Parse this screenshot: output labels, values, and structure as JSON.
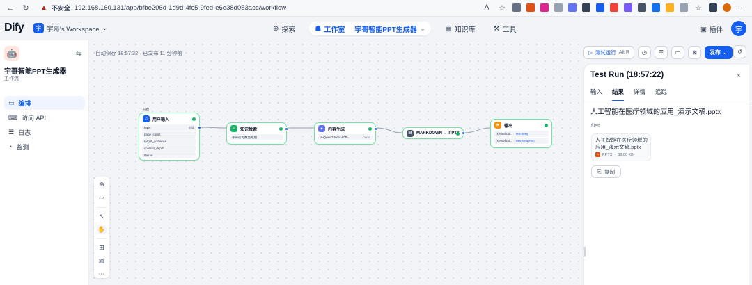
{
  "browser": {
    "insecure_label": "不安全",
    "url": "192.168.160.131/app/bfbe206d-1d9d-4fc5-9fed-e6e38d053acc/workflow"
  },
  "header": {
    "logo": "Dify",
    "workspace_initial": "宇",
    "workspace": "宇哥's Workspace",
    "nav": {
      "explore": "探索",
      "studio": "工作室",
      "app": "宇哥智能PPT生成器",
      "knowledge": "知识库",
      "tools": "工具"
    },
    "plugins": "插件",
    "user_initial": "宇"
  },
  "sidebar": {
    "app_name": "宇哥智能PPT生成器",
    "app_type": "工作流",
    "items": [
      "编排",
      "访问 API",
      "日志",
      "监测"
    ]
  },
  "canvas": {
    "autosave": "自动保存 18:57:32 · 已发布 11 分钟前"
  },
  "nodes": {
    "start": {
      "badge": "开始",
      "title": "用户输入",
      "fields": [
        {
          "name": "topic",
          "tag": "必填"
        },
        {
          "name": "page_count",
          "tag": ""
        },
        {
          "name": "target_audience",
          "tag": ""
        },
        {
          "name": "content_depth",
          "tag": ""
        },
        {
          "name": "theme",
          "tag": ""
        }
      ]
    },
    "knowledge": {
      "title": "知识检索",
      "detail": "宇哥行为数量规划"
    },
    "llm": {
      "title": "内容生成",
      "detail": "M-Qwen3-Next-80B-...",
      "mode": "CHAT"
    },
    "markdown": {
      "title": "MARKDOWN → PPTX"
    },
    "output": {
      "title": "输出",
      "fields": [
        {
          "name": "(x)Markdo...",
          "type": "text:String"
        },
        {
          "name": "(x)Markdo...",
          "type": "files:Array[File]"
        }
      ]
    }
  },
  "run_toolbar": {
    "test_run": "测试运行",
    "shortcut": "Alt R",
    "publish": "发布"
  },
  "panel": {
    "title": "Test Run (18:57:22)",
    "tabs": [
      "输入",
      "结果",
      "详情",
      "追踪"
    ],
    "active_tab": 1,
    "result_text": "人工智能在医疗领域的应用_演示文稿.pptx",
    "files_label": "files",
    "file": {
      "name": "人工智能在医疗领域的应用_演示文稿.pptx",
      "type_label": "PPTX",
      "size": "38.00 KB",
      "icon_text": "P"
    },
    "copy_label": "复制"
  },
  "colors": {
    "accent": "#155eef",
    "success": "#17b26a",
    "node_border_ok": "#75e0a7"
  }
}
